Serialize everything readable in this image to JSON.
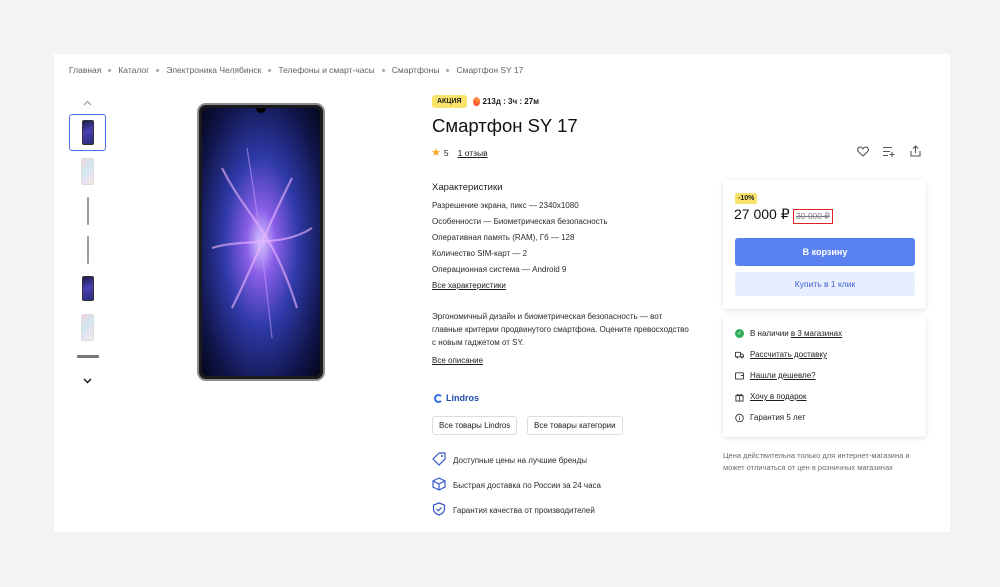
{
  "breadcrumb": [
    "Главная",
    "Каталог",
    "Электроника Челябинск",
    "Телефоны и смарт-часы",
    "Смартфоны",
    "Смартфон SY 17"
  ],
  "promo": {
    "badge": "АКЦИЯ",
    "timer": "213д : 3ч : 27м"
  },
  "product": {
    "title": "Смартфон SY 17",
    "rating": "5",
    "reviews": "1 отзыв"
  },
  "specs": {
    "title": "Характеристики",
    "items": [
      "Разрешение экрана, пикс — 2340х1080",
      "Особенности — Биометрическая безопасность",
      "Оперативная память (RAM), Гб — 128",
      "Количество SIM-карт — 2",
      "Операционная система — Android 9"
    ],
    "all_link": "Все характеристики"
  },
  "description": {
    "text": "Эргономичный дизайн и биометрическая безопасность — вот главные критерии продвинутого смартфона. Оцените превосходство с новым гаджетом от SY.",
    "all_link": "Все описание"
  },
  "brand": {
    "name": "Lindros",
    "btn_brand": "Все товары Lindros",
    "btn_category": "Все товары категории"
  },
  "features": [
    "Доступные цены на лучшие бренды",
    "Быстрая доставка по России за 24 часа",
    "Гарантия качества от производителей"
  ],
  "price": {
    "discount": "-10%",
    "current": "27 000 ₽",
    "old": "30 000 ₽",
    "cart_button": "В корзину",
    "one_click_button": "Купить в 1 клик"
  },
  "info": {
    "stock_prefix": "В наличии ",
    "stock_link": "в 3 магазинах",
    "delivery": "Рассчитать доставку",
    "cheaper": "Нашли дешевле?",
    "gift": "Хочу в подарок",
    "warranty": "Гарантия 5 лет"
  },
  "note": "Цена действительна только для интернет-магазина и может отличаться от цен в розничных магазинах",
  "colors": {
    "accent": "#5a81f0",
    "promo": "#f9e36a",
    "brand": "#1f4ea8",
    "ok": "#2fae5a",
    "highlight": "#e02121"
  }
}
